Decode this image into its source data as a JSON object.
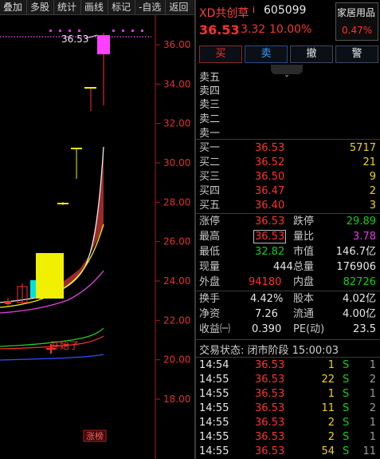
{
  "toolbar": {
    "items": [
      "叠加",
      "多股",
      "统计",
      "画线",
      "标记",
      "-自选",
      "返回"
    ]
  },
  "chart_data": {
    "type": "candlestick",
    "y_axis": {
      "min": 16,
      "max": 37,
      "ticks": [
        "36.00",
        "34.00",
        "32.00",
        "30.00",
        "28.00",
        "26.00",
        "24.00",
        "22.00",
        "20.00",
        "18.00"
      ]
    },
    "price_line_label": "36.53",
    "annotation": "开始了",
    "bottom_label": "涨榜",
    "colors": {
      "up": "#ff3030",
      "down": "#00d0d0",
      "ma_white": "#e8e8e8",
      "ma_yellow": "#f0f000",
      "ma_magenta": "#e040e0",
      "ma_green": "#20d020",
      "ma_blue": "#3050ff",
      "cloud": "#9b2a2a"
    }
  },
  "header": {
    "name": "XD共创草",
    "info_icon": "i",
    "code": "605099",
    "sector": "家居用品",
    "sector_change": "0.47%",
    "price": "36.53",
    "change": "3.32",
    "change_pct": "10.00%"
  },
  "buttons": {
    "buy": "买",
    "sell": "卖",
    "cancel": "撤",
    "alert": "警"
  },
  "ask": {
    "labels": [
      "卖五",
      "卖四",
      "卖三",
      "卖二",
      "卖一"
    ]
  },
  "bid": [
    {
      "label": "买一",
      "price": "36.53",
      "vol": "5717"
    },
    {
      "label": "买二",
      "price": "36.52",
      "vol": "21"
    },
    {
      "label": "买三",
      "price": "36.50",
      "vol": "9"
    },
    {
      "label": "买四",
      "price": "36.47",
      "vol": "2"
    },
    {
      "label": "买五",
      "price": "36.40",
      "vol": "3"
    }
  ],
  "quote": {
    "limit_up_label": "涨停",
    "limit_up": "36.53",
    "limit_down_label": "跌停",
    "limit_down": "29.89",
    "high_label": "最高",
    "high": "36.53",
    "vol_ratio_label": "量比",
    "vol_ratio": "3.78",
    "low_label": "最低",
    "low": "32.82",
    "mkt_cap_label": "市值",
    "mkt_cap": "146.7亿",
    "cur_vol_label": "现量",
    "cur_vol": "444",
    "total_vol_label": "总量",
    "total_vol": "176906",
    "outer_label": "外盘",
    "outer": "94180",
    "inner_label": "内盘",
    "inner": "82726",
    "turnover_label": "换手",
    "turnover": "4.42%",
    "equity_label": "股本",
    "equity": "4.02亿",
    "nav_label": "净资",
    "nav": "7.26",
    "float_label": "流通",
    "float": "4.00亿",
    "eps_label": "收益㈠",
    "eps": "0.390",
    "pe_label": "PE(动)",
    "pe": "23.5"
  },
  "status": {
    "text": "交易状态: 闭市阶段 15:00:03"
  },
  "trades": [
    {
      "time": "14:54",
      "price": "36.53",
      "vol": "1",
      "side": "S",
      "count": "1"
    },
    {
      "time": "14:55",
      "price": "36.53",
      "vol": "22",
      "side": "S",
      "count": "2"
    },
    {
      "time": "14:55",
      "price": "36.53",
      "vol": "1",
      "side": "S",
      "count": "1"
    },
    {
      "time": "14:55",
      "price": "36.53",
      "vol": "11",
      "side": "S",
      "count": "2"
    },
    {
      "time": "14:55",
      "price": "36.53",
      "vol": "2",
      "side": "S",
      "count": "1"
    },
    {
      "time": "14:55",
      "price": "36.53",
      "vol": "2",
      "side": "S",
      "count": "1"
    },
    {
      "time": "14:55",
      "price": "36.53",
      "vol": "54",
      "side": "S",
      "count": "11"
    }
  ]
}
